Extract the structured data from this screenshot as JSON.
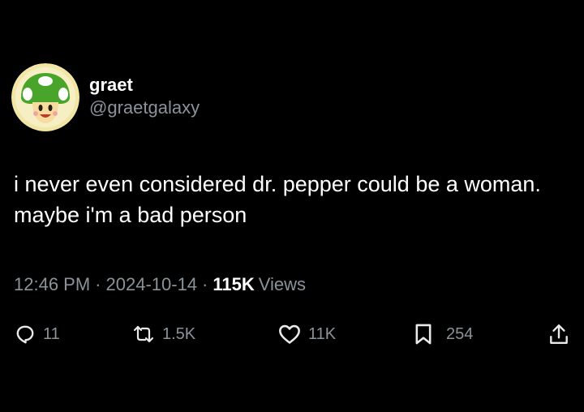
{
  "user": {
    "display_name": "graet",
    "handle": "@graetgalaxy",
    "avatar_icon": "green-mushroom-avatar-icon"
  },
  "tweet": {
    "text": "i never even considered dr. pepper could be a woman. maybe i'm a bad person"
  },
  "meta": {
    "time": "12:46 PM",
    "separator": "·",
    "date": "2024-10-14",
    "views_count": "115K",
    "views_label": "Views"
  },
  "actions": {
    "reply": {
      "icon": "reply-icon",
      "count": "11"
    },
    "repost": {
      "icon": "repost-icon",
      "count": "1.5K"
    },
    "like": {
      "icon": "heart-icon",
      "count": "11K"
    },
    "bookmark": {
      "icon": "bookmark-icon",
      "count": "254"
    },
    "share": {
      "icon": "share-icon"
    }
  },
  "colors": {
    "background": "#000000",
    "text_primary": "#ffffff",
    "text_secondary": "#8b9299",
    "avatar_ring": "#f2e6a6",
    "avatar_green": "#49a52a"
  }
}
